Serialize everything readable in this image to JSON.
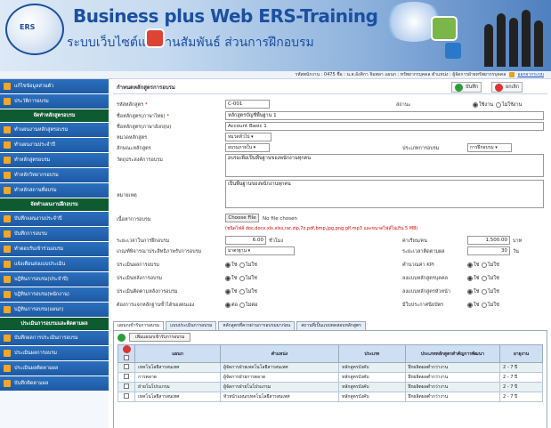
{
  "header": {
    "title": "Business plus Web ERS-Training",
    "subtitle": "ระบบเว็บไซต์แรงงานสัมพันธ์ ส่วนการฝึกอบรม",
    "logo_text": "ERS"
  },
  "infobar": {
    "user_text": "รหัสพนักงาน : 0475  ชื่อ : น.ส.อังคิกา จิมพลา  แผนก : ทรัพยากรบุคคล  ตำแหน่ง : ผู้จัดการฝ่ายทรัพยากรบุคคล",
    "link": "ออกจากระบบ"
  },
  "sidebar": {
    "items": [
      {
        "type": "item",
        "label": "แก้ไขข้อมูลส่วนตัว"
      },
      {
        "type": "item",
        "label": "ประวัติการอบรม"
      },
      {
        "type": "header",
        "label": "จัดทำหลักสูตรอบรม"
      },
      {
        "type": "item",
        "label": "ทำแผนงานหลักสูตรอบรม"
      },
      {
        "type": "item",
        "label": "ทำแผนงานประจำปี"
      },
      {
        "type": "item",
        "label": "ทำหลักสูตรอบรม"
      },
      {
        "type": "item",
        "label": "ทำหลักวิทยากรอบรม"
      },
      {
        "type": "item",
        "label": "ทำหลักสถานที่อบรม"
      },
      {
        "type": "header",
        "label": "จัดทำแผนงานฝึกอบรม"
      },
      {
        "type": "item",
        "label": "บันทึกแผนงานประจำปี"
      },
      {
        "type": "item",
        "label": "บันทึกการอบรม"
      },
      {
        "type": "item",
        "label": "ทำตอบรับเข้าร่วมอบรม"
      },
      {
        "type": "item",
        "label": "แจ้งเตือนส่งแบบประเมิน"
      },
      {
        "type": "item",
        "label": "บฎิทินการอบรม(ประจำปี)"
      },
      {
        "type": "item",
        "label": "บฎิทินการอบรม(พนักงาน)"
      },
      {
        "type": "item",
        "label": "บฎิทินการอบรม(แผนก)"
      },
      {
        "type": "header",
        "label": "ประเมินการอบรมและติดตามผล"
      },
      {
        "type": "item",
        "label": "บันทึกผลการประเมินการอบรม"
      },
      {
        "type": "item",
        "label": "ประเมินผลการอบรม"
      },
      {
        "type": "item",
        "label": "ประเมินผลติดตามผล"
      },
      {
        "type": "item",
        "label": "บันทึกติดตามผล"
      }
    ]
  },
  "main": {
    "title": "กำหนดหลักสูตรการอบรม",
    "save_label": "บันทึก",
    "cancel_label": "ยกเลิก",
    "form": {
      "course_code_label": "รหัสหลักสูตร",
      "course_code_value": "C-001",
      "status_label": "สถานะ",
      "status_on": "ใช้งาน",
      "status_off": "ไม่ใช้งาน",
      "name_th_label": "ชื่อหลักสูตร(ภาษาไทย)",
      "name_th_value": "หลักสูตรบัญชีพื้นฐาน 1",
      "name_en_label": "ชื่อหลักสูตร(ภาษาอังกฤษ)",
      "name_en_value": "Account Basic 1",
      "group_label": "หมวดหลักสูตร",
      "group_value": "หมวดทั่วไป",
      "type_label": "ลักษณะหลักสูตร",
      "type_value": "อบรมภายใน",
      "course_type_label": "ประเภทการอบรม",
      "course_type_value": "การฝึกอบรม",
      "objective_label": "วัตถุประสงค์การอบรม",
      "objective_value": "อบรมเพื่อเป็นพื้นฐานของพนักงานทุกคน",
      "note_label": "หมายเหตุ",
      "note_value": "เป็นพื้นฐานของพนักงานทุกคน",
      "content_label": "เนื้อหาการอบรม",
      "file_button": "Choose File",
      "file_status": "No file chosen",
      "file_hint": "(ชนิดไฟล์ doc,docx,xls,xlsx,rar,zip,7z,pdf,bmp,jpg,png,gif,mp3 และขนาดไฟล์ไม่เกิน 5 MB)",
      "hours_label": "ระยะเวลาในการฝึกอบรม",
      "hours_value": "6.00",
      "hours_unit": "ชั่วโมง",
      "cost_label": "ค่าเรียน/คน",
      "cost_value": "1,500.00",
      "cost_unit": "บาท",
      "criteria_label": "เกณฑ์พิจารณาประสิทธิภาพรับการอบรม",
      "criteria_value": "มาตรฐาน",
      "days_label": "ระยะเวลาติดตามผล",
      "days_value": "30",
      "days_unit": "วัน",
      "eval_label": "ประเมินผลการอบรม",
      "kpi_label": "คำนวณค่า KPI",
      "eval2_label": "ประเมินหลังการอบรม",
      "sup_label": "ลงแบบหลักสูตรบุคคล",
      "eval3_label": "ประเมินติดตามหลังการอบรม",
      "sup2_label": "ลงแบบหลักสูตรหัวหน้า",
      "repeat_label": "ต้องการแจกหลักฐานซ้ำได้ของตนเอง",
      "cert_label": "มีใบประกาศนียบัตร",
      "yes": "ใช่",
      "no": "ไม่ใช่",
      "yes2": "ต่อ",
      "no2": "ไม่ต่อ"
    },
    "tabs": [
      "แผนกเข้ารับการอบรม",
      "แบบประเมินการอบรม",
      "หลักสูตรที่ควรผ่านการอบรมมาก่อน",
      "สถานที่เป็นแบบทดสอบหลักสูตร"
    ],
    "add_button": "เพิ่มแผนกเข้ารับการอบรม",
    "table": {
      "headers": [
        "แผนก",
        "ตำแหน่ง",
        "ประเภท",
        "ประเภทหลักสูตรสำคัญการพัฒนา",
        "อายุงาน"
      ],
      "rows": [
        [
          "เทคโนโลยีสารสนเทศ",
          "ผู้จัดการฝ่ายเทคโนโลยีสารสนเทศ",
          "หลักสูตรบังคับ",
          "ฝึกผลิตผลต่ำกว่างาน",
          "2 - 7 ปี"
        ],
        [
          "การตลาด",
          "ผู้จัดการฝ่ายการตลาด",
          "หลักสูตรบังคับ",
          "ฝึกผลิตผลต่ำกว่างาน",
          "2 - 7 ปี"
        ],
        [
          "ฝ่ายโนโปรแกรม",
          "ผู้จัดการฝ่ายโนโปรแกรม",
          "หลักสูตรบังคับ",
          "ฝึกผลิตผลต่ำกว่างาน",
          "2 - 7 ปี"
        ],
        [
          "เทคโนโลยีสารสนเทศ",
          "หัวหน้าแผนกเทคโนโลยีสารสนเทศ",
          "หลักสูตรบังคับ",
          "ฝึกผลิตผลต่ำกว่างาน",
          "2 - 7 ปี"
        ]
      ]
    }
  },
  "colors": {
    "sidebar_item": "#2a6fbe",
    "sidebar_header": "#0e5b32",
    "accent": "#1b4fa0",
    "required": "#dd0000"
  }
}
